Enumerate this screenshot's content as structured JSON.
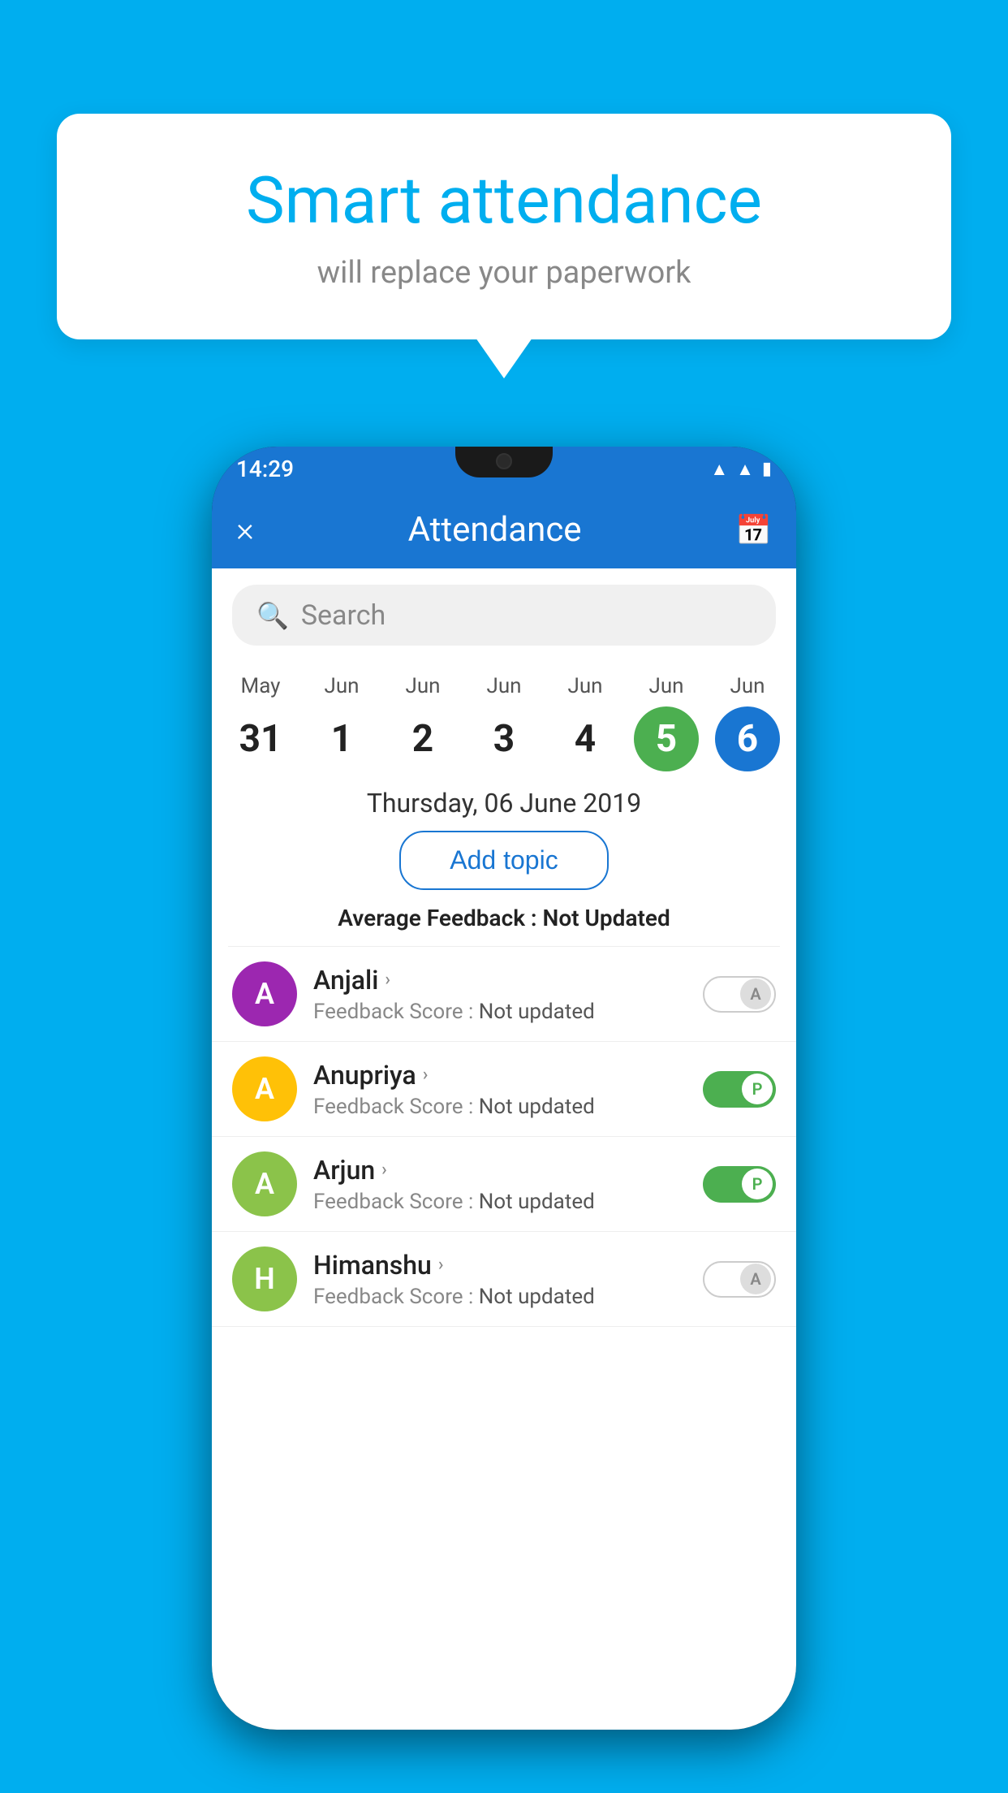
{
  "background_color": "#00AEEF",
  "speech_bubble": {
    "title": "Smart attendance",
    "subtitle": "will replace your paperwork"
  },
  "status_bar": {
    "time": "14:29"
  },
  "app_bar": {
    "title": "Attendance",
    "close_label": "×",
    "calendar_icon": "📅"
  },
  "search": {
    "placeholder": "Search"
  },
  "dates": [
    {
      "month": "May",
      "day": "31",
      "state": "normal"
    },
    {
      "month": "Jun",
      "day": "1",
      "state": "normal"
    },
    {
      "month": "Jun",
      "day": "2",
      "state": "normal"
    },
    {
      "month": "Jun",
      "day": "3",
      "state": "normal"
    },
    {
      "month": "Jun",
      "day": "4",
      "state": "normal"
    },
    {
      "month": "Jun",
      "day": "5",
      "state": "today"
    },
    {
      "month": "Jun",
      "day": "6",
      "state": "selected"
    }
  ],
  "selected_date_label": "Thursday, 06 June 2019",
  "add_topic_label": "Add topic",
  "avg_feedback_label": "Average Feedback :",
  "avg_feedback_value": "Not Updated",
  "students": [
    {
      "name": "Anjali",
      "avatar_letter": "A",
      "avatar_color": "#9C27B0",
      "feedback_label": "Feedback Score :",
      "feedback_value": "Not updated",
      "toggle_state": "off",
      "toggle_label": "A"
    },
    {
      "name": "Anupriya",
      "avatar_letter": "A",
      "avatar_color": "#FFC107",
      "feedback_label": "Feedback Score :",
      "feedback_value": "Not updated",
      "toggle_state": "on",
      "toggle_label": "P"
    },
    {
      "name": "Arjun",
      "avatar_letter": "A",
      "avatar_color": "#8BC34A",
      "feedback_label": "Feedback Score :",
      "feedback_value": "Not updated",
      "toggle_state": "on",
      "toggle_label": "P"
    },
    {
      "name": "Himanshu",
      "avatar_letter": "H",
      "avatar_color": "#8BC34A",
      "feedback_label": "Feedback Score :",
      "feedback_value": "Not updated",
      "toggle_state": "off",
      "toggle_label": "A"
    }
  ]
}
